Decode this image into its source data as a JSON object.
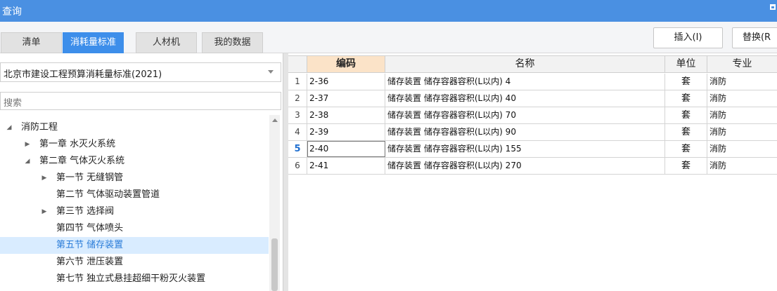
{
  "window": {
    "title": "查询",
    "max_icon": "maximize-icon"
  },
  "tabs": [
    {
      "label": "清单",
      "active": false
    },
    {
      "label": "消耗量标准",
      "active": true
    },
    {
      "label": "人材机",
      "active": false
    },
    {
      "label": "我的数据",
      "active": false
    }
  ],
  "toolbar": {
    "insert_label": "插入(I)",
    "replace_label": "替换(R"
  },
  "standard_select": {
    "value": "北京市建设工程预算消耗量标准(2021)"
  },
  "search": {
    "placeholder": "搜索"
  },
  "tree": [
    {
      "label": "消防工程",
      "level": 0,
      "expanded": true
    },
    {
      "label": "第一章 水灭火系统",
      "level": 1,
      "expanded": false
    },
    {
      "label": "第二章 气体灭火系统",
      "level": 1,
      "expanded": true
    },
    {
      "label": "第一节 无缝钢管",
      "level": 2,
      "expanded": false
    },
    {
      "label": "第二节 气体驱动装置管道",
      "level": 2,
      "leaf": true
    },
    {
      "label": "第三节 选择阀",
      "level": 2,
      "expanded": false
    },
    {
      "label": "第四节 气体喷头",
      "level": 2,
      "leaf": true
    },
    {
      "label": "第五节 储存装置",
      "level": 2,
      "leaf": true,
      "selected": true
    },
    {
      "label": "第六节 泄压装置",
      "level": 2,
      "leaf": true
    },
    {
      "label": "第七节 独立式悬挂超细干粉灭火装置",
      "level": 2,
      "leaf": true
    }
  ],
  "table": {
    "columns": [
      "",
      "编码",
      "名称",
      "单位",
      "专业"
    ],
    "rows": [
      {
        "no": "1",
        "code": "2-36",
        "name": "储存装置 储存容器容积(L以内) 4",
        "unit": "套",
        "spec": "消防"
      },
      {
        "no": "2",
        "code": "2-37",
        "name": "储存装置 储存容器容积(L以内) 40",
        "unit": "套",
        "spec": "消防"
      },
      {
        "no": "3",
        "code": "2-38",
        "name": "储存装置 储存容器容积(L以内) 70",
        "unit": "套",
        "spec": "消防"
      },
      {
        "no": "4",
        "code": "2-39",
        "name": "储存装置 储存容器容积(L以内) 90",
        "unit": "套",
        "spec": "消防"
      },
      {
        "no": "5",
        "code": "2-40",
        "name": "储存装置 储存容器容积(L以内) 155",
        "unit": "套",
        "spec": "消防",
        "current": true
      },
      {
        "no": "6",
        "code": "2-41",
        "name": "储存装置 储存容器容积(L以内) 270",
        "unit": "套",
        "spec": "消防"
      }
    ]
  },
  "colors": {
    "accent": "#3d8eea",
    "titlebar": "#4a90e2",
    "selection": "#d9ecff",
    "sorted_header": "#fbe3c8"
  }
}
